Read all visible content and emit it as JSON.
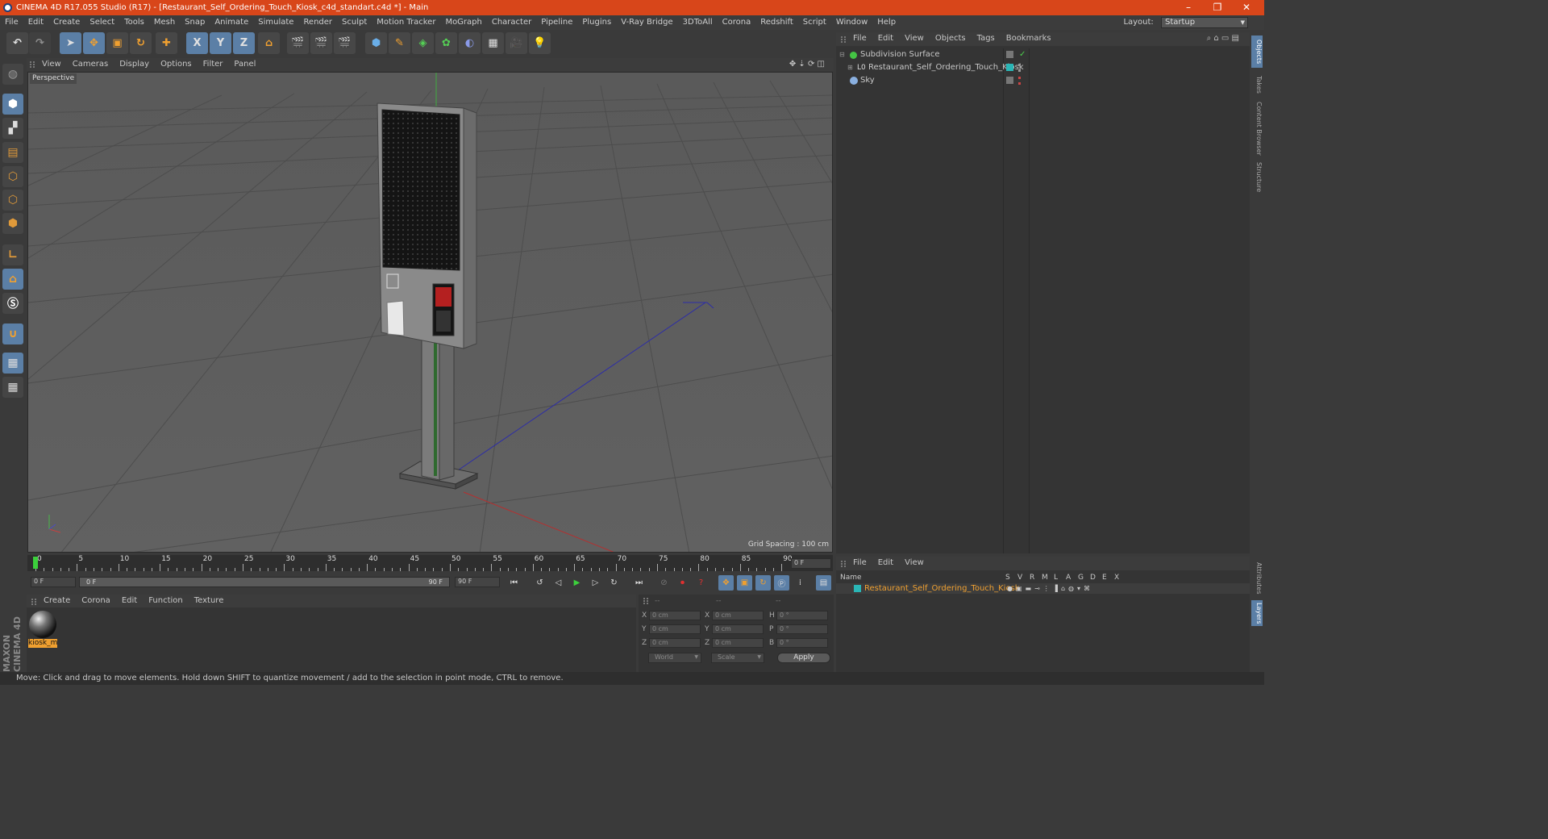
{
  "window": {
    "title": "CINEMA 4D R17.055 Studio (R17) - [Restaurant_Self_Ordering_Touch_Kiosk_c4d_standart.c4d *] - Main",
    "minimize": "–",
    "restore": "❐",
    "close": "✕"
  },
  "menu": {
    "items": [
      "File",
      "Edit",
      "Create",
      "Select",
      "Tools",
      "Mesh",
      "Snap",
      "Animate",
      "Simulate",
      "Render",
      "Sculpt",
      "Motion Tracker",
      "MoGraph",
      "Character",
      "Pipeline",
      "Plugins",
      "V-Ray Bridge",
      "3DToAll",
      "Corona",
      "Redshift",
      "Script",
      "Window",
      "Help"
    ],
    "layout_label": "Layout:",
    "layout_value": "Startup"
  },
  "toolbar": {
    "axis_x": "X",
    "axis_y": "Y",
    "axis_z": "Z"
  },
  "viewport": {
    "menu": [
      "View",
      "Cameras",
      "Display",
      "Options",
      "Filter",
      "Panel"
    ],
    "label": "Perspective",
    "grid_spacing": "Grid Spacing : 100 cm"
  },
  "object_manager": {
    "menu": [
      "File",
      "Edit",
      "View",
      "Objects",
      "Tags",
      "Bookmarks"
    ],
    "objects": [
      {
        "name": "Subdivision Surface"
      },
      {
        "name": "Restaurant_Self_Ordering_Touch_Kiosk"
      },
      {
        "name": "Sky"
      }
    ]
  },
  "side_tabs": [
    "Objects",
    "Takes",
    "Content Browser",
    "Structure",
    "Attributes",
    "Layers"
  ],
  "layer_manager": {
    "menu": [
      "File",
      "Edit",
      "View"
    ],
    "columns": [
      "Name",
      "S",
      "V",
      "R",
      "M",
      "L",
      "A",
      "G",
      "D",
      "E",
      "X"
    ],
    "rows": [
      {
        "name": "Restaurant_Self_Ordering_Touch_Kiosk",
        "color": "#2ab6b6"
      }
    ]
  },
  "timeline": {
    "ticks": [
      "0",
      "5",
      "10",
      "15",
      "20",
      "25",
      "30",
      "35",
      "40",
      "45",
      "50",
      "55",
      "60",
      "65",
      "70",
      "75",
      "80",
      "85",
      "90"
    ],
    "current_frame": "0 F"
  },
  "playback": {
    "start": "0 F",
    "range_start": "0 F",
    "range_end": "90 F",
    "end": "90 F"
  },
  "material_manager": {
    "menu": [
      "Create",
      "Corona",
      "Edit",
      "Function",
      "Texture"
    ],
    "material_name": "kiosk_m"
  },
  "coordinates": {
    "headers": [
      "--",
      "--",
      "--"
    ],
    "rows": [
      {
        "a": "X",
        "av": "0 cm",
        "b": "X",
        "bv": "0 cm",
        "c": "H",
        "cv": "0 °"
      },
      {
        "a": "Y",
        "av": "0 cm",
        "b": "Y",
        "bv": "0 cm",
        "c": "P",
        "cv": "0 °"
      },
      {
        "a": "Z",
        "av": "0 cm",
        "b": "Z",
        "bv": "0 cm",
        "c": "B",
        "cv": "0 °"
      }
    ],
    "space": "World",
    "mode": "Scale",
    "apply": "Apply"
  },
  "brand": "MAXON CINEMA 4D",
  "status": "Move: Click and drag to move elements. Hold down SHIFT to quantize movement / add to the selection in point mode, CTRL to remove.",
  "colors": {
    "title_bar": "#d8461a",
    "accent_blue": "#5b7fa6",
    "selection_orange": "#f0a030"
  }
}
